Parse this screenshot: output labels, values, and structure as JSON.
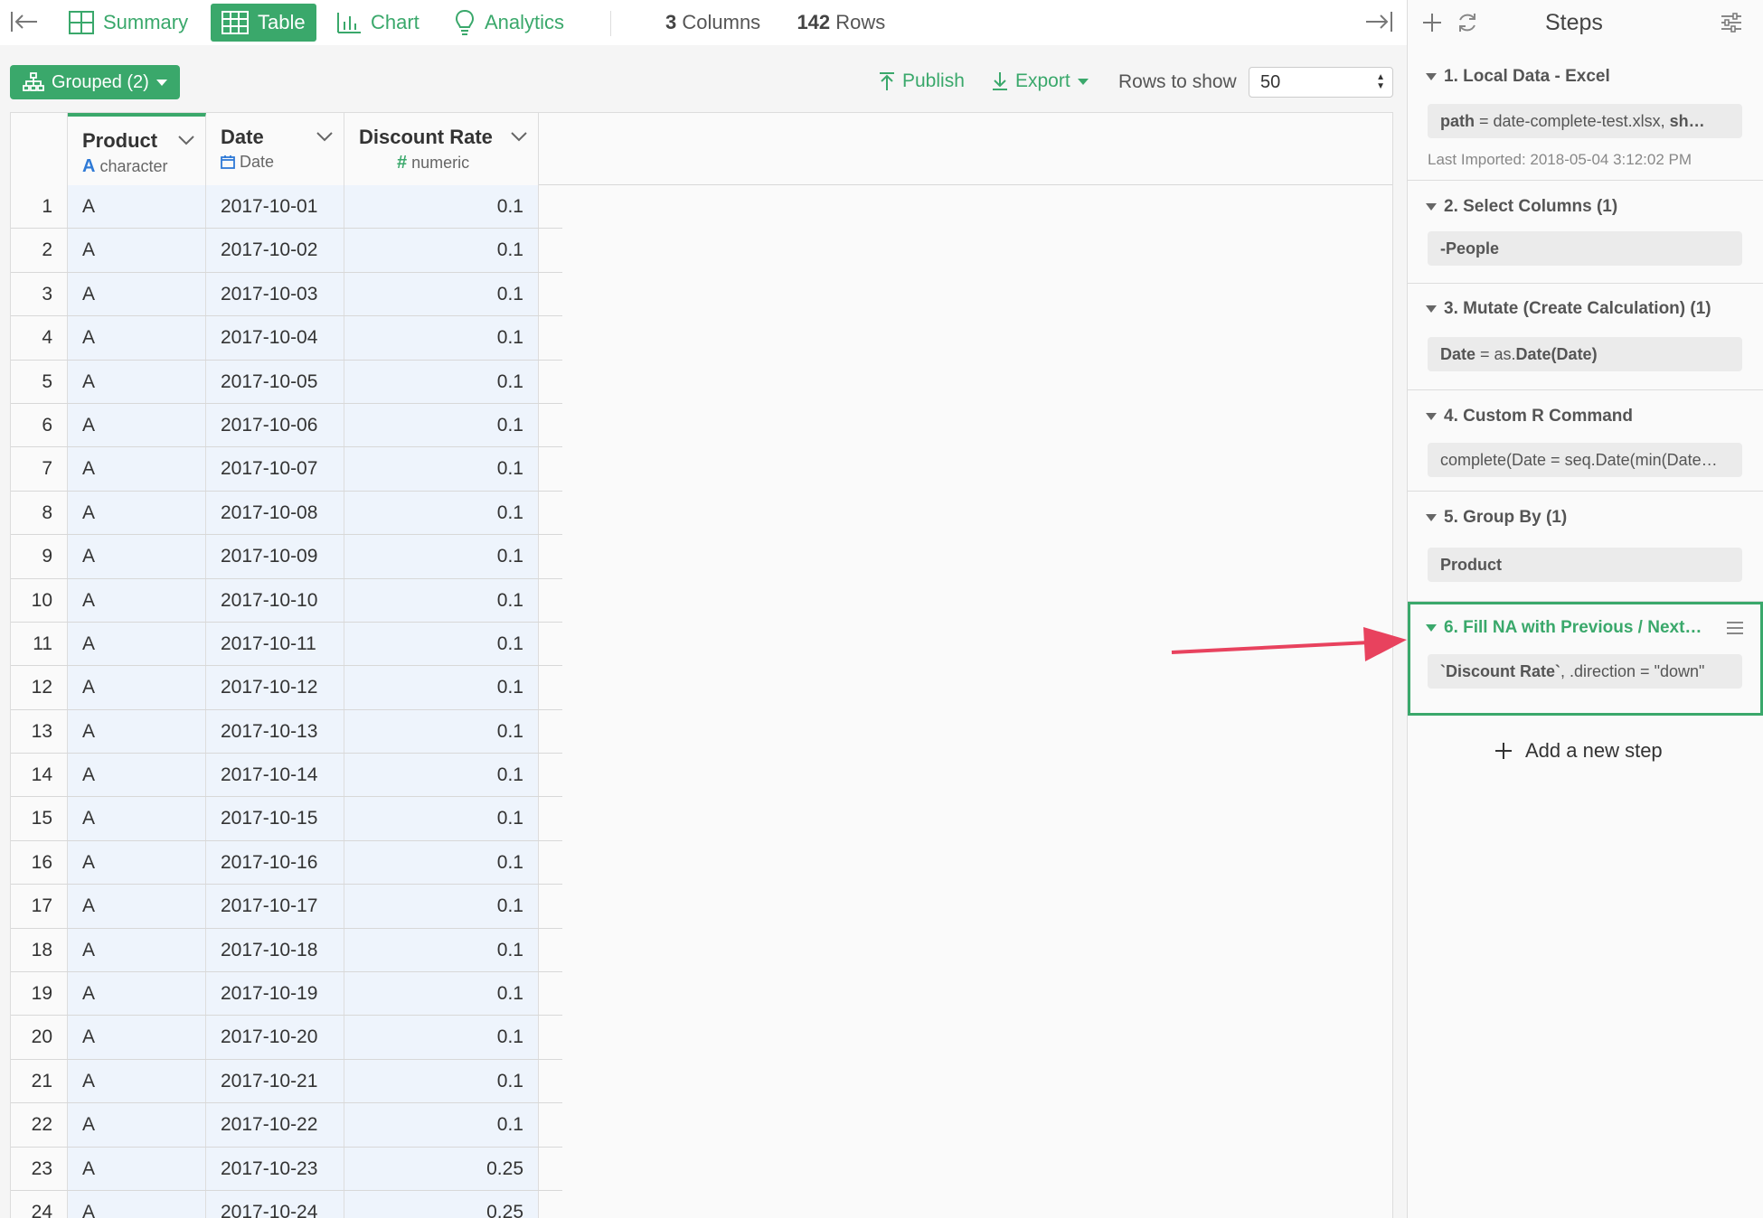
{
  "topbar": {
    "tabs": [
      {
        "label": "Summary",
        "icon": "summary-icon"
      },
      {
        "label": "Table",
        "icon": "table-icon",
        "active": true
      },
      {
        "label": "Chart",
        "icon": "chart-icon"
      },
      {
        "label": "Analytics",
        "icon": "lightbulb-icon"
      }
    ],
    "columns_count": "3",
    "columns_label": "Columns",
    "rows_count": "142",
    "rows_label": "Rows"
  },
  "toolbar": {
    "grouped_label": "Grouped (2)",
    "publish_label": "Publish",
    "export_label": "Export",
    "rows_to_show_label": "Rows to show",
    "rows_to_show_value": "50"
  },
  "table": {
    "columns": [
      {
        "name": "Product",
        "type_icon": "A",
        "type": "character"
      },
      {
        "name": "Date",
        "type_icon": "calendar-icon",
        "type": "Date"
      },
      {
        "name": "Discount Rate",
        "type_icon": "#",
        "type": "numeric"
      }
    ],
    "rows": [
      [
        "1",
        "A",
        "2017-10-01",
        "0.1"
      ],
      [
        "2",
        "A",
        "2017-10-02",
        "0.1"
      ],
      [
        "3",
        "A",
        "2017-10-03",
        "0.1"
      ],
      [
        "4",
        "A",
        "2017-10-04",
        "0.1"
      ],
      [
        "5",
        "A",
        "2017-10-05",
        "0.1"
      ],
      [
        "6",
        "A",
        "2017-10-06",
        "0.1"
      ],
      [
        "7",
        "A",
        "2017-10-07",
        "0.1"
      ],
      [
        "8",
        "A",
        "2017-10-08",
        "0.1"
      ],
      [
        "9",
        "A",
        "2017-10-09",
        "0.1"
      ],
      [
        "10",
        "A",
        "2017-10-10",
        "0.1"
      ],
      [
        "11",
        "A",
        "2017-10-11",
        "0.1"
      ],
      [
        "12",
        "A",
        "2017-10-12",
        "0.1"
      ],
      [
        "13",
        "A",
        "2017-10-13",
        "0.1"
      ],
      [
        "14",
        "A",
        "2017-10-14",
        "0.1"
      ],
      [
        "15",
        "A",
        "2017-10-15",
        "0.1"
      ],
      [
        "16",
        "A",
        "2017-10-16",
        "0.1"
      ],
      [
        "17",
        "A",
        "2017-10-17",
        "0.1"
      ],
      [
        "18",
        "A",
        "2017-10-18",
        "0.1"
      ],
      [
        "19",
        "A",
        "2017-10-19",
        "0.1"
      ],
      [
        "20",
        "A",
        "2017-10-20",
        "0.1"
      ],
      [
        "21",
        "A",
        "2017-10-21",
        "0.1"
      ],
      [
        "22",
        "A",
        "2017-10-22",
        "0.1"
      ],
      [
        "23",
        "A",
        "2017-10-23",
        "0.25"
      ],
      [
        "24",
        "A",
        "2017-10-24",
        "0.25"
      ]
    ]
  },
  "steps": {
    "title": "Steps",
    "items": [
      {
        "title": "1. Local Data - Excel",
        "cmd_key": "path",
        "cmd_rest": " = date-complete-test.xlsx, ",
        "cmd_tail": "sh…",
        "meta": "Last Imported: 2018-05-04 3:12:02 PM"
      },
      {
        "title": "2. Select Columns (1)",
        "cmd": "-People"
      },
      {
        "title": "3. Mutate (Create Calculation) (1)",
        "cmd_key": "Date",
        "cmd_rest": " = as.",
        "cmd_tail": "Date(Date)"
      },
      {
        "title": "4. Custom R Command",
        "cmd": "complete(Date = seq.Date(min(Date…"
      },
      {
        "title": "5. Group By (1)",
        "cmd": "Product"
      },
      {
        "title": "6. Fill NA with Previous / Next…",
        "cmd_key": "`Discount Rate`",
        "cmd_rest": ", .direction = \"down\"",
        "selected": true
      }
    ],
    "add_label": "Add a new step"
  },
  "colors": {
    "accent": "#3aa86b",
    "annotation_arrow": "#e8425e",
    "cell_highlight": "#eef4fc"
  }
}
